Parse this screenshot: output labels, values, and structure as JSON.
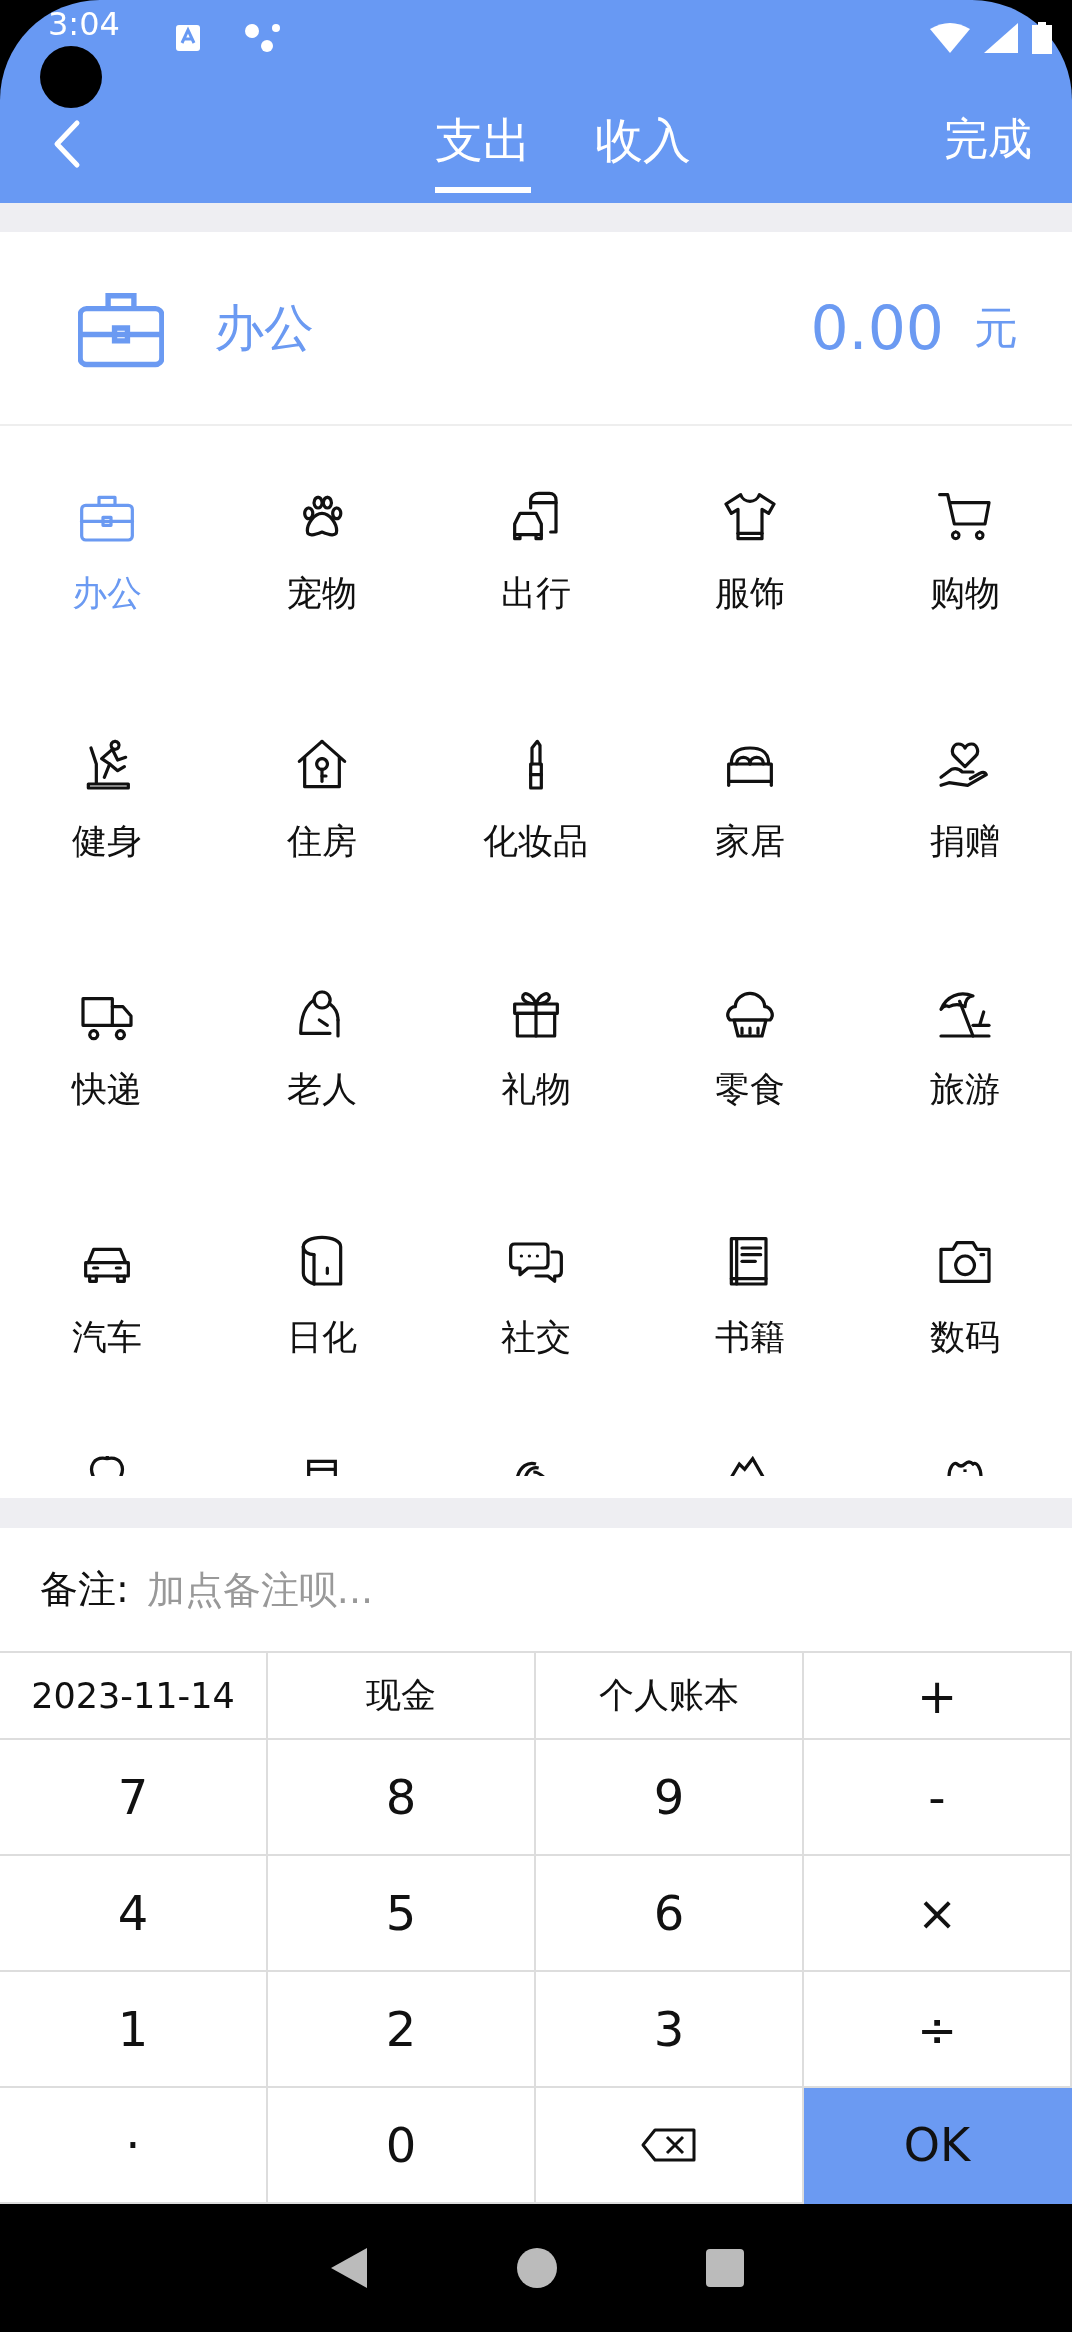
{
  "status_bar": {
    "time": "3:04"
  },
  "header": {
    "tabs": [
      {
        "label": "支出",
        "selected": true
      },
      {
        "label": "收入",
        "selected": false
      }
    ],
    "done": "完成"
  },
  "current": {
    "name": "办公",
    "amount": "0.00",
    "unit": "元"
  },
  "categories": [
    {
      "label": "办公",
      "selected": true
    },
    {
      "label": "宠物",
      "selected": false
    },
    {
      "label": "出行",
      "selected": false
    },
    {
      "label": "服饰",
      "selected": false
    },
    {
      "label": "购物",
      "selected": false
    },
    {
      "label": "健身",
      "selected": false
    },
    {
      "label": "住房",
      "selected": false
    },
    {
      "label": "化妆品",
      "selected": false
    },
    {
      "label": "家居",
      "selected": false
    },
    {
      "label": "捐赠",
      "selected": false
    },
    {
      "label": "快递",
      "selected": false
    },
    {
      "label": "老人",
      "selected": false
    },
    {
      "label": "礼物",
      "selected": false
    },
    {
      "label": "零食",
      "selected": false
    },
    {
      "label": "旅游",
      "selected": false
    },
    {
      "label": "汽车",
      "selected": false
    },
    {
      "label": "日化",
      "selected": false
    },
    {
      "label": "社交",
      "selected": false
    },
    {
      "label": "书籍",
      "selected": false
    },
    {
      "label": "数码",
      "selected": false
    }
  ],
  "note": {
    "label": "备注:",
    "placeholder": "加点备注呗..."
  },
  "keypad": [
    [
      {
        "kind": "field",
        "label": "2023-11-14"
      },
      {
        "kind": "field",
        "label": "现金"
      },
      {
        "kind": "field",
        "label": "个人账本"
      },
      {
        "kind": "key",
        "label": "+"
      }
    ],
    [
      {
        "kind": "key",
        "label": "7"
      },
      {
        "kind": "key",
        "label": "8"
      },
      {
        "kind": "key",
        "label": "9"
      },
      {
        "kind": "key",
        "label": "-"
      }
    ],
    [
      {
        "kind": "key",
        "label": "4"
      },
      {
        "kind": "key",
        "label": "5"
      },
      {
        "kind": "key",
        "label": "6"
      },
      {
        "kind": "key",
        "label": "×"
      }
    ],
    [
      {
        "kind": "key",
        "label": "1"
      },
      {
        "kind": "key",
        "label": "2"
      },
      {
        "kind": "key",
        "label": "3"
      },
      {
        "kind": "key",
        "label": "÷"
      }
    ],
    [
      {
        "kind": "key",
        "label": "·"
      },
      {
        "kind": "key",
        "label": "0"
      },
      {
        "kind": "backspace"
      },
      {
        "kind": "ok",
        "label": "OK"
      }
    ]
  ]
}
